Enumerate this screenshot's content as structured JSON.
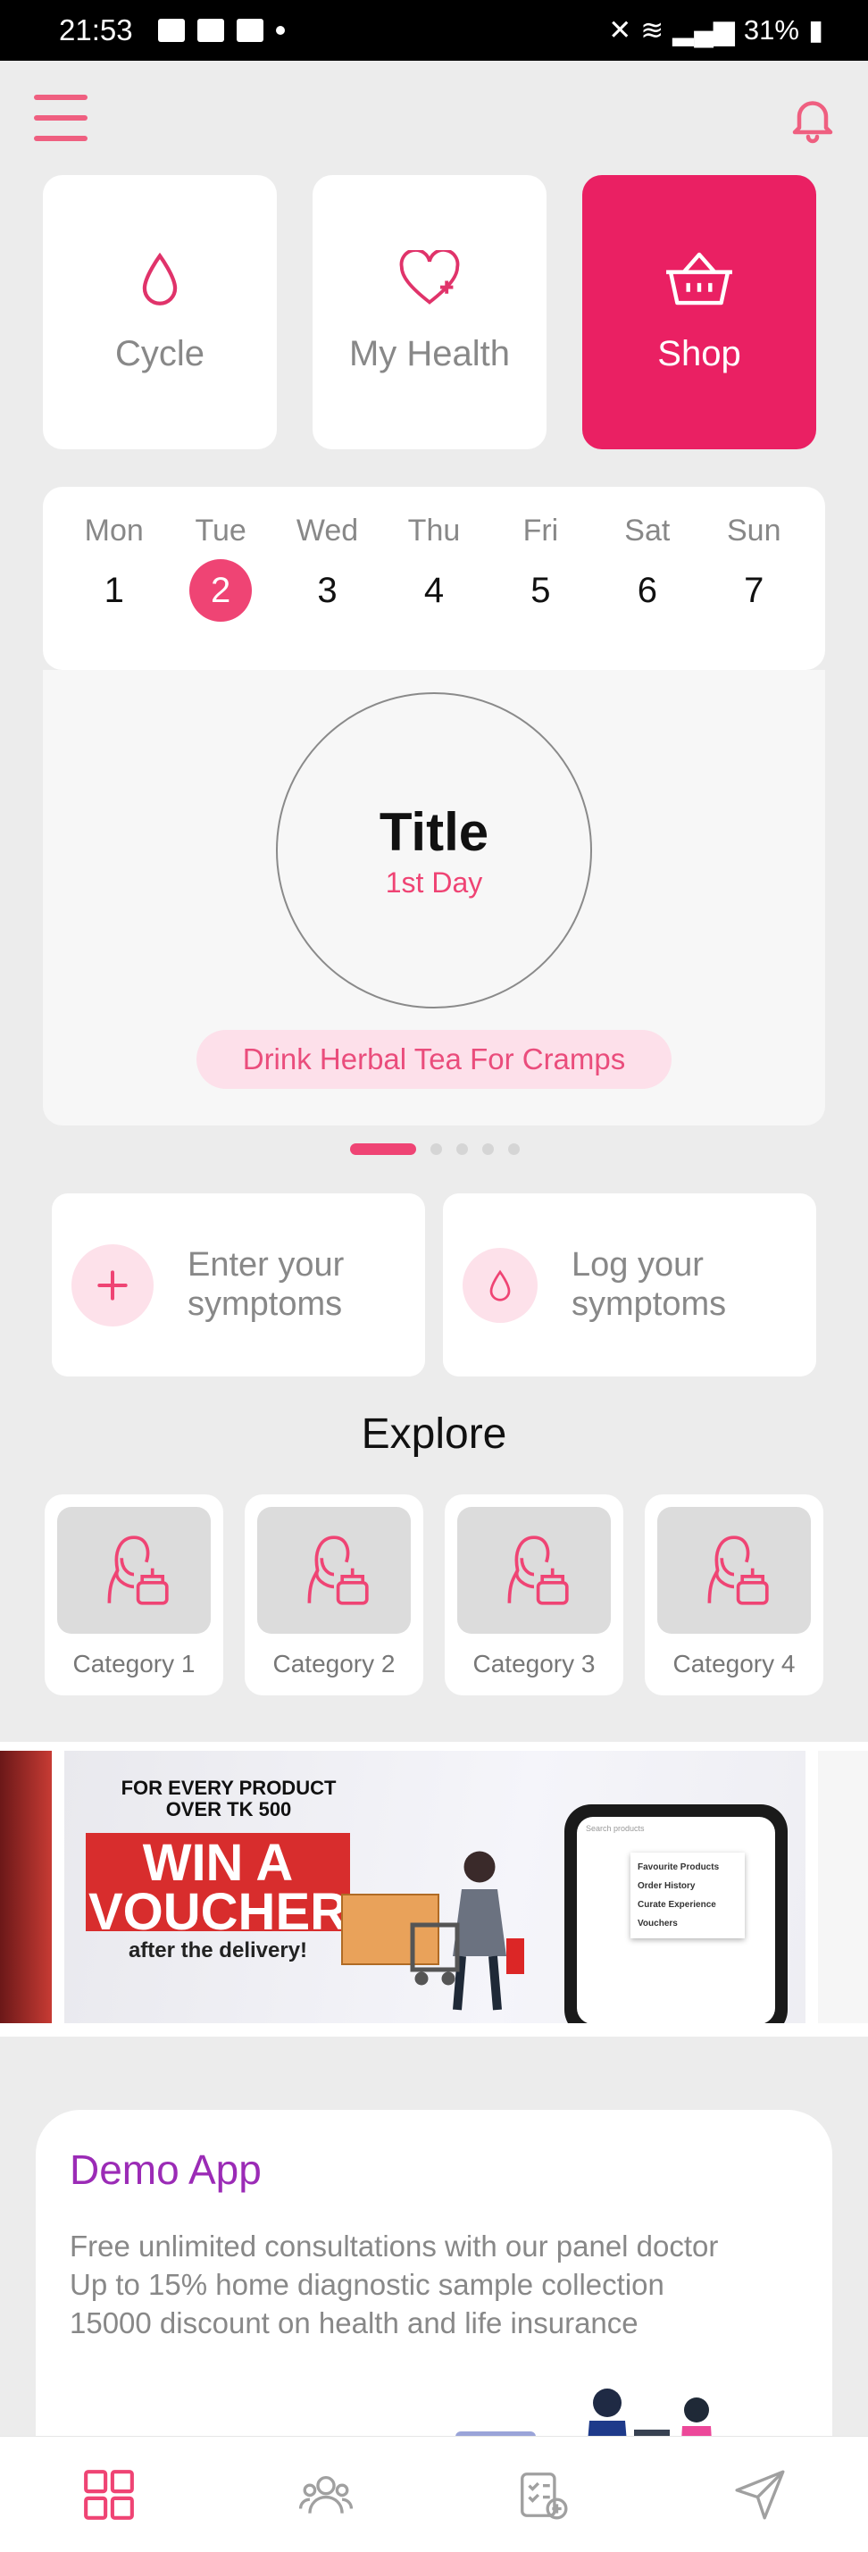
{
  "status_bar": {
    "time": "21:53",
    "battery": "31%"
  },
  "top_tiles": [
    {
      "label": "Cycle",
      "icon": "drop-icon",
      "active": false
    },
    {
      "label": "My Health",
      "icon": "heart-plus-icon",
      "active": false
    },
    {
      "label": "Shop",
      "icon": "basket-icon",
      "active": true
    }
  ],
  "calendar": {
    "days": [
      {
        "name": "Mon",
        "num": "1"
      },
      {
        "name": "Tue",
        "num": "2"
      },
      {
        "name": "Wed",
        "num": "3"
      },
      {
        "name": "Thu",
        "num": "4"
      },
      {
        "name": "Fri",
        "num": "5"
      },
      {
        "name": "Sat",
        "num": "6"
      },
      {
        "name": "Sun",
        "num": "7"
      }
    ],
    "selected_index": 1
  },
  "cycle": {
    "title": "Title",
    "subtitle": "1st Day",
    "tip": "Drink Herbal Tea For Cramps"
  },
  "actions": [
    {
      "label": "Enter your symptoms",
      "icon": "plus-icon"
    },
    {
      "label": "Log your symptoms",
      "icon": "drop-icon"
    }
  ],
  "explore": {
    "title": "Explore",
    "categories": [
      "Category 1",
      "Category 2",
      "Category 3",
      "Category 4"
    ]
  },
  "banner": {
    "small_text": "FOR EVERY PRODUCT OVER TK 500",
    "big_text": "WIN A VOUCHER",
    "after_text": "after the delivery!",
    "menu_items": [
      "Favourite Products",
      "Order History",
      "Curate Experience",
      "Vouchers"
    ],
    "search_placeholder": "Search products"
  },
  "demo": {
    "title": "Demo App",
    "lines": [
      "Free unlimited consultations with our panel doctor",
      "Up to 15% home diagnostic sample collection",
      "15000 discount on health and life insurance"
    ]
  },
  "colors": {
    "accent": "#ea2063",
    "pink_light": "#fde0ea",
    "purple": "#9b2bb6"
  },
  "bottom_nav": [
    "grid-icon",
    "community-icon",
    "checklist-icon",
    "send-icon"
  ]
}
